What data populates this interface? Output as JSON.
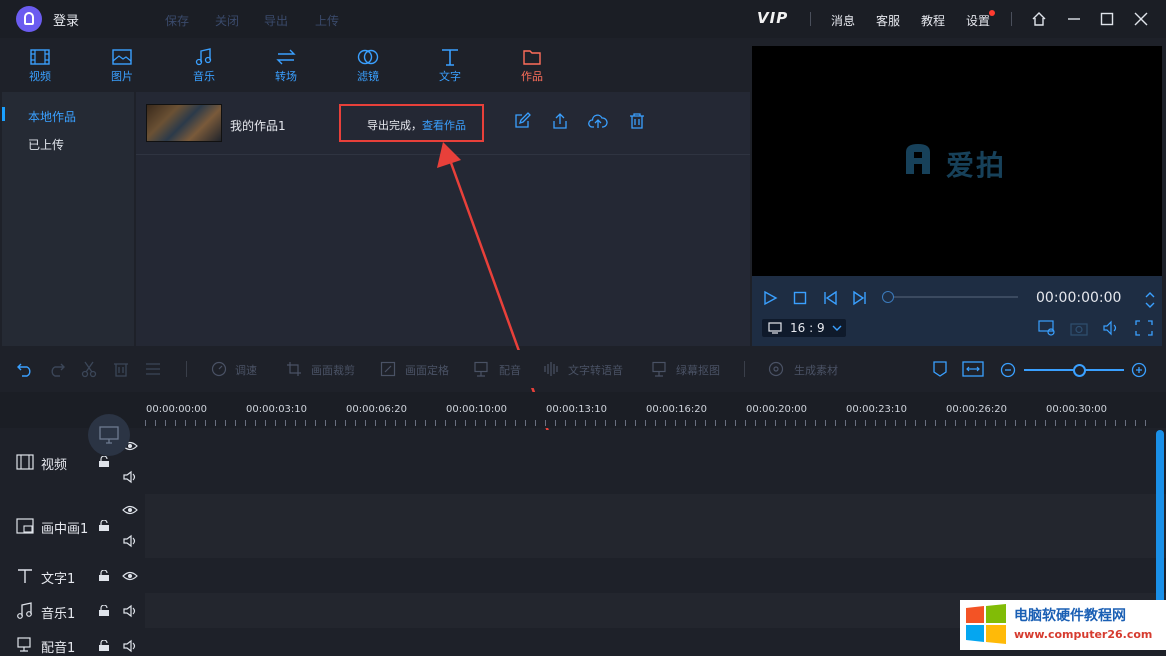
{
  "titlebar": {
    "login": "登录",
    "menu": [
      "保存",
      "关闭",
      "导出",
      "上传"
    ],
    "vip": "VIP",
    "links": [
      "消息",
      "客服",
      "教程",
      "设置"
    ]
  },
  "tools": [
    {
      "label": "视频",
      "icon": "film-icon"
    },
    {
      "label": "图片",
      "icon": "image-icon"
    },
    {
      "label": "音乐",
      "icon": "music-icon"
    },
    {
      "label": "转场",
      "icon": "transition-icon"
    },
    {
      "label": "滤镜",
      "icon": "filter-icon"
    },
    {
      "label": "文字",
      "icon": "text-icon"
    },
    {
      "label": "作品",
      "icon": "folder-icon"
    }
  ],
  "sidebar": {
    "items": [
      "本地作品",
      "已上传"
    ]
  },
  "work": {
    "name": "我的作品1",
    "status": "导出完成，",
    "status_link": "查看作品"
  },
  "preview": {
    "brand": "爱拍",
    "timecode": "00:00:00:00",
    "ratio": "16 : 9"
  },
  "edit_tools": [
    "调速",
    "画面裁剪",
    "画面定格",
    "配音",
    "文字转语音",
    "绿幕抠图",
    "生成素材"
  ],
  "ruler": [
    "00:00:00:00",
    "00:00:03:10",
    "00:00:06:20",
    "00:00:10:00",
    "00:00:13:10",
    "00:00:16:20",
    "00:00:20:00",
    "00:00:23:10",
    "00:00:26:20",
    "00:00:30:00"
  ],
  "tracks": [
    "视频",
    "画中画1",
    "文字1",
    "音乐1",
    "配音1"
  ],
  "watermark": {
    "title": "电脑软硬件教程网",
    "url": "www.computer26.com"
  },
  "colors": {
    "accent": "#3aa0ff",
    "highlight": "#e8403a",
    "active_tool": "#ff6e5a"
  }
}
